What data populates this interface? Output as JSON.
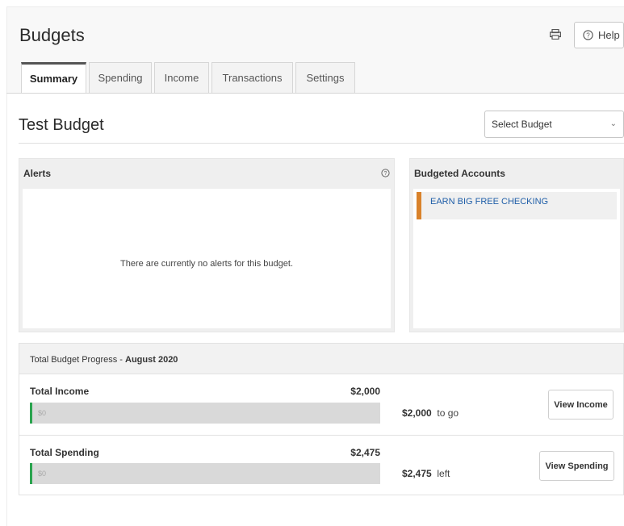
{
  "header": {
    "title": "Budgets",
    "print_icon": "print-icon",
    "help_label": "Help",
    "help_icon": "question-circle-icon"
  },
  "tabs": [
    {
      "label": "Summary",
      "active": true
    },
    {
      "label": "Spending",
      "active": false
    },
    {
      "label": "Income",
      "active": false
    },
    {
      "label": "Transactions",
      "active": false
    },
    {
      "label": "Settings",
      "active": false
    }
  ],
  "budget": {
    "name": "Test Budget",
    "select_label": "Select Budget",
    "select_icon": "chevron-down-icon"
  },
  "alerts": {
    "title": "Alerts",
    "info_icon": "question-circle-icon",
    "empty_text": "There are currently no alerts for this budget."
  },
  "accounts": {
    "title": "Budgeted Accounts",
    "items": [
      {
        "name": "EARN BIG FREE CHECKING",
        "color": "#d9822b"
      }
    ]
  },
  "progress": {
    "title_prefix": "Total Budget Progress - ",
    "period": "August 2020",
    "income": {
      "label": "Total Income",
      "total": "$2,000",
      "current": "$0",
      "remaining": "$2,000",
      "remaining_suffix": "to go",
      "button": "View Income",
      "progress_fraction": 0
    },
    "spending": {
      "label": "Total Spending",
      "total": "$2,475",
      "current": "$0",
      "remaining": "$2,475",
      "remaining_suffix": "left",
      "button": "View Spending",
      "progress_fraction": 0
    }
  },
  "colors": {
    "accent_green": "#2aa44f",
    "account_orange": "#d9822b",
    "link_blue": "#1f5ea8"
  }
}
